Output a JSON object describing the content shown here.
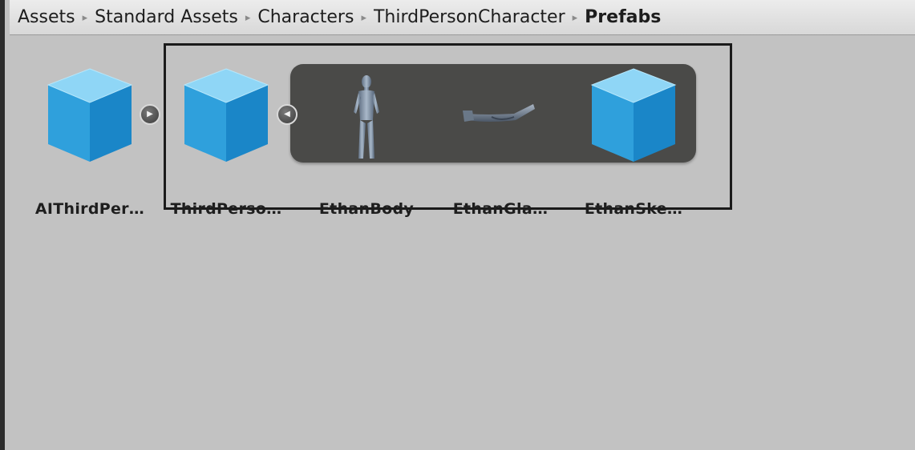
{
  "breadcrumb": {
    "items": [
      "Assets",
      "Standard Assets",
      "Characters",
      "ThirdPersonCharacter"
    ],
    "current": "Prefabs",
    "separator": "▸"
  },
  "assets": [
    {
      "label": "AIThirdPer…",
      "icon": "prefab-cube-icon"
    },
    {
      "label": "ThirdPerso…",
      "icon": "prefab-cube-icon"
    },
    {
      "label": "EthanBody",
      "icon": "character-mesh-icon"
    },
    {
      "label": "EthanGla…",
      "icon": "glasses-mesh-icon"
    },
    {
      "label": "EthanSke…",
      "icon": "prefab-cube-icon"
    }
  ],
  "buttons": {
    "expand_glyph": "▶",
    "collapse_glyph": "◀"
  },
  "colors": {
    "cube_top": "#8fd6f6",
    "cube_left": "#2fa0dc",
    "cube_right": "#1a86c8",
    "panel_bg": "#4a4a48",
    "window_bg": "#c2c2c2"
  }
}
